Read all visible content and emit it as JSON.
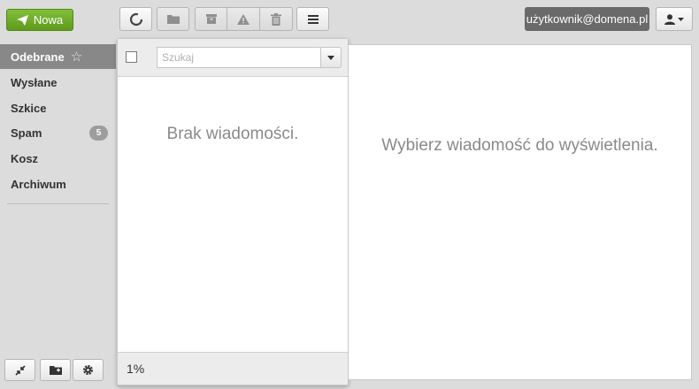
{
  "toolbar": {
    "new_label": "Nowa",
    "icons": {
      "new": "paper-plane-icon",
      "refresh": "spinner-icon",
      "folder": "folder-icon",
      "archive": "archive-box-icon",
      "spam": "warning-icon",
      "delete": "trash-icon",
      "menu": "menu-icon",
      "user": "user-icon"
    }
  },
  "account": {
    "email": "użytkownik@domena.pl"
  },
  "sidebar": {
    "folders": [
      {
        "label": "Odebrane",
        "active": true
      },
      {
        "label": "Wysłane"
      },
      {
        "label": "Szkice"
      },
      {
        "label": "Spam",
        "count": "5"
      },
      {
        "label": "Kosz"
      },
      {
        "label": "Archiwum"
      }
    ]
  },
  "message_list": {
    "search_placeholder": "Szukaj",
    "empty_text": "Brak wiadomości.",
    "quota": "1%"
  },
  "preview": {
    "empty_text": "Wybierz wiadomość do wyświetlenia."
  },
  "colors": {
    "accent_green": "#6aa628",
    "active_folder": "#888888",
    "user_badge": "#6a6a6a"
  }
}
